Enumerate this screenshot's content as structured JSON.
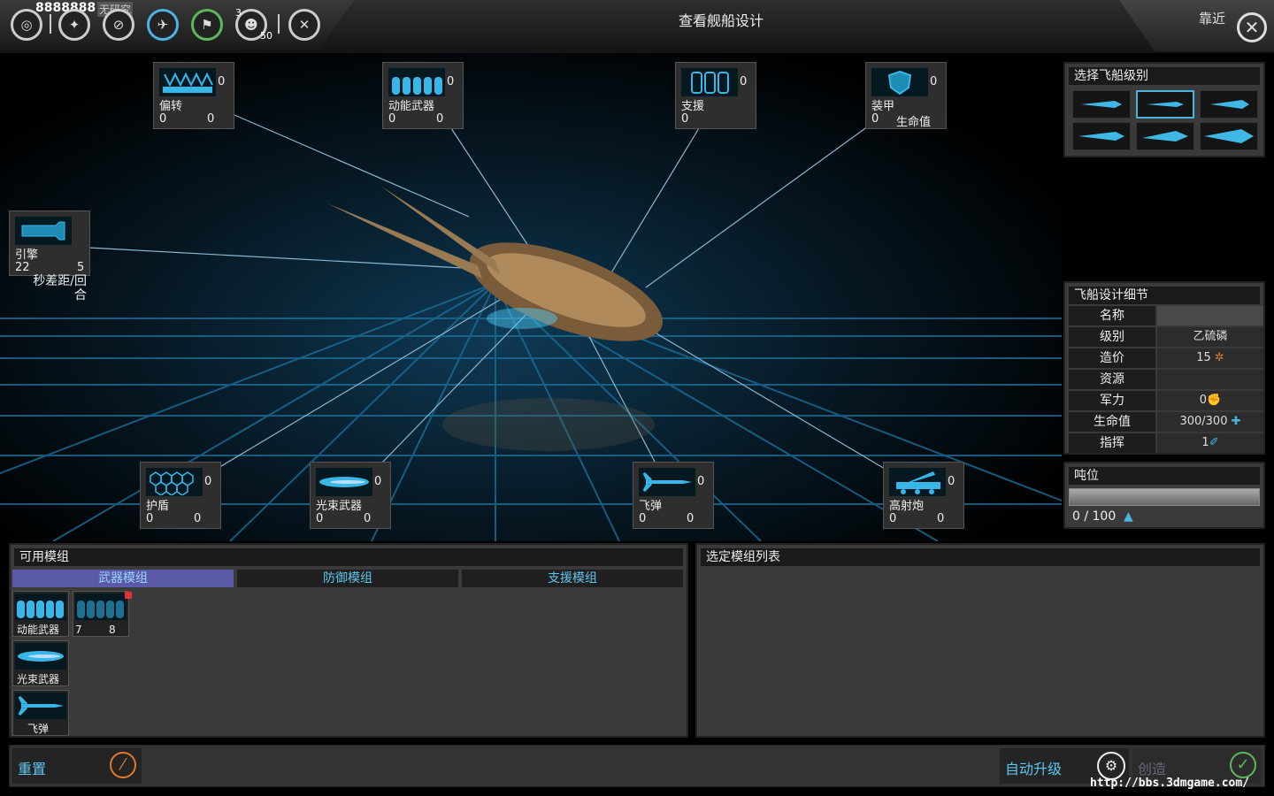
{
  "topbar": {
    "money": "8888888",
    "research_label": "无研究",
    "badge_a": "3",
    "badge_b": "50",
    "title": "查看舰船设计",
    "zoom_label": "靠近"
  },
  "slots": {
    "deflect": {
      "count": "0",
      "name": "偏转",
      "a": "0",
      "b": "0"
    },
    "kinetic": {
      "count": "0",
      "name": "动能武器",
      "a": "0",
      "b": "0"
    },
    "support": {
      "count": "0",
      "name": "支援",
      "a": "0"
    },
    "armor": {
      "count": "0",
      "name": "装甲",
      "a": "0",
      "b": "生命值"
    },
    "engine": {
      "name": "引擎",
      "a": "22",
      "b": "5",
      "note": "秒差距/回合"
    },
    "shield": {
      "count": "0",
      "name": "护盾",
      "a": "0",
      "b": "0"
    },
    "beam": {
      "count": "0",
      "name": "光束武器",
      "a": "0",
      "b": "0"
    },
    "missile": {
      "count": "0",
      "name": "飞弹",
      "a": "0",
      "b": "0"
    },
    "artillery": {
      "count": "0",
      "name": "高射炮",
      "a": "0",
      "b": "0"
    }
  },
  "class_panel": {
    "title": "选择飞船级别"
  },
  "details": {
    "title": "飞船设计细节",
    "rows": [
      {
        "k": "名称",
        "v": ""
      },
      {
        "k": "级别",
        "v": "乙硫磷"
      },
      {
        "k": "造价",
        "v": "15"
      },
      {
        "k": "资源",
        "v": ""
      },
      {
        "k": "军力",
        "v": "0"
      },
      {
        "k": "生命值",
        "v": "300/300"
      },
      {
        "k": "指挥",
        "v": "1"
      }
    ]
  },
  "tonnage": {
    "title": "吨位",
    "value": "0 / 100",
    "fill_fraction": 0
  },
  "modules": {
    "title": "可用模组",
    "tabs": [
      "武器模组",
      "防御模组",
      "支援模组"
    ],
    "items": [
      {
        "name": "动能武器"
      },
      {
        "name": "",
        "a": "7",
        "b": "8"
      },
      {
        "name": "光束武器"
      },
      {
        "name": "飞弹"
      }
    ]
  },
  "selected": {
    "title": "选定模组列表"
  },
  "bottom": {
    "reset": "重置",
    "auto": "自动升级",
    "create": "创造",
    "watermark": "http://bbs.3dmgame.com/"
  },
  "colors": {
    "accent": "#4ab3e0",
    "tab_active": "#5a5aa8",
    "cost_icon": "#e07a2a"
  }
}
